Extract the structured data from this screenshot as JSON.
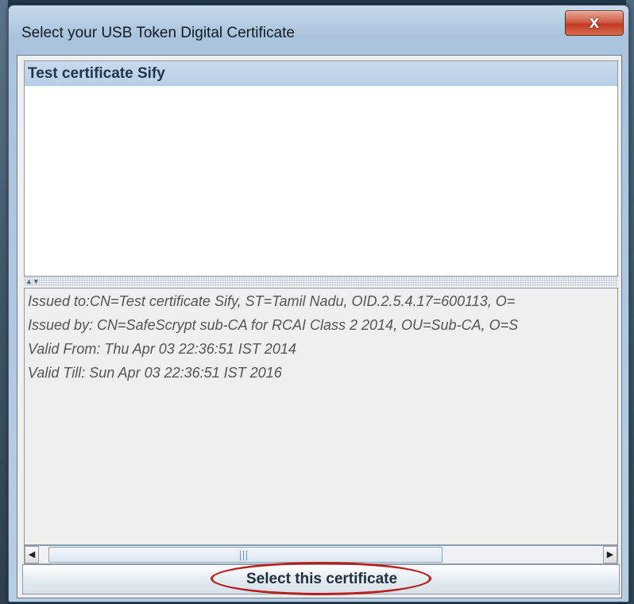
{
  "window": {
    "title": "Select your USB Token Digital Certificate",
    "close_glyph": "x",
    "close_icon": "close-icon"
  },
  "certificate_list": {
    "items": [
      {
        "label": "Test certificate Sify",
        "selected": true
      }
    ]
  },
  "split_divider": {
    "arrows": "▲▼"
  },
  "details": {
    "issued_to": "Issued to:CN=Test certificate Sify, ST=Tamil Nadu, OID.2.5.4.17=600113, O=",
    "issued_by": "Issued by: CN=SafeScrypt sub-CA for RCAI Class 2 2014, OU=Sub-CA, O=S",
    "valid_from": "Valid From: Thu Apr 03 22:36:51 IST 2014",
    "valid_till": "Valid Till: Sun Apr 03 22:36:51 IST 2016"
  },
  "scrollbar": {
    "left_arrow": "◀",
    "right_arrow": "▶",
    "thumb_grip_icon": "grip-icon"
  },
  "actions": {
    "select_label": "Select this certificate"
  },
  "colors": {
    "annotation_ellipse": "#b8201f",
    "selection_bg": "#b8cfe6",
    "close_button": "#c0391f"
  }
}
